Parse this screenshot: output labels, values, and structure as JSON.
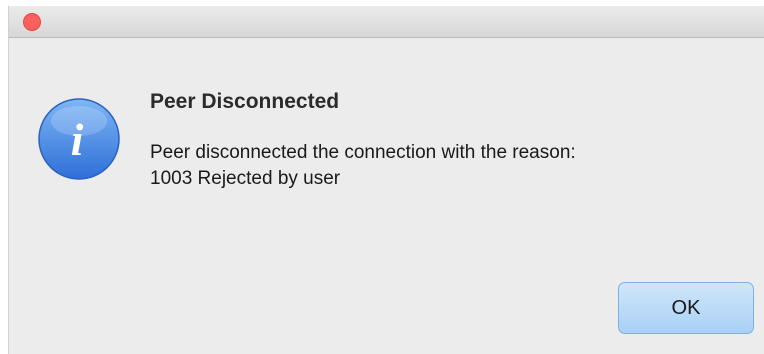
{
  "window": {
    "close_color": "#fc605c"
  },
  "dialog": {
    "icon": "info-icon",
    "icon_glyph": "i",
    "accent_color": "#3b7fe4",
    "title": "Peer Disconnected",
    "message": "Peer disconnected the connection with the reason:\n1003 Rejected by user",
    "ok_label": "OK"
  }
}
